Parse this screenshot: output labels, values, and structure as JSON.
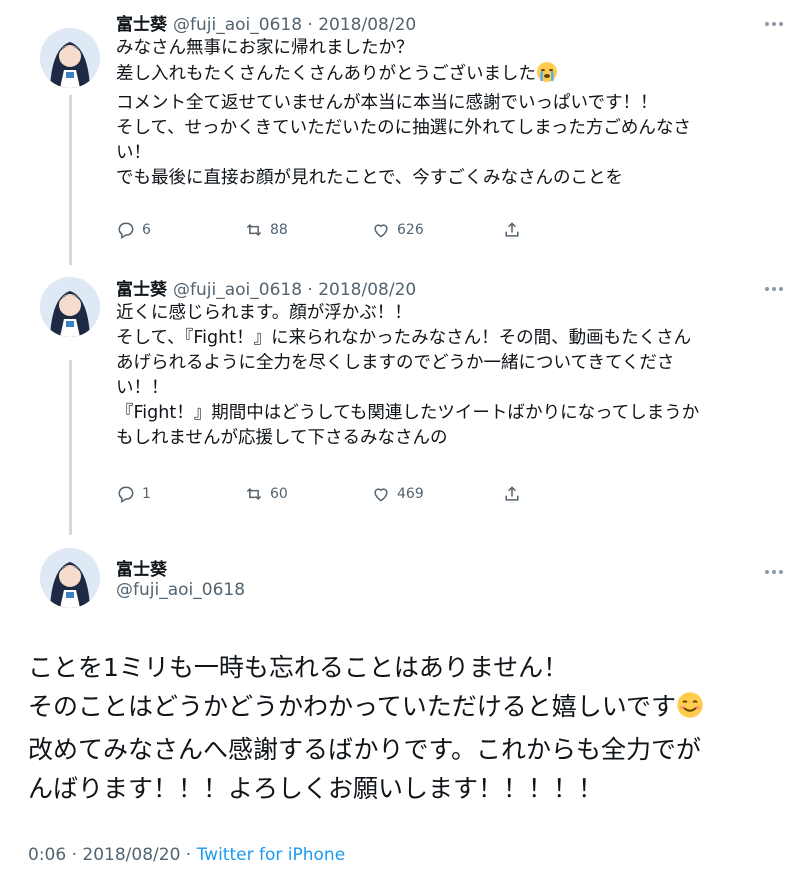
{
  "tweets": [
    {
      "name": "富士葵",
      "handle": "@fuji_aoi_0618",
      "date": "2018/08/20",
      "lines": [
        "みなさん無事にお家に帰れましたか？",
        "差し入れもたくさんたくさんありがとうございました",
        "コメント全て返せていませんが本当に本当に感謝でいっぱいです！！",
        "そして、せっかくきていただいたのに抽選に外れてしまった方ごめんなさ",
        "い！",
        "でも最後に直接お顔が見れたことで、今すごくみなさんのことを"
      ],
      "replies": "6",
      "retweets": "88",
      "likes": "626"
    },
    {
      "name": "富士葵",
      "handle": "@fuji_aoi_0618",
      "date": "2018/08/20",
      "lines": [
        "近くに感じられます。顔が浮かぶ！！",
        "そして、『Fight！』に来られなかったみなさん！その間、動画もたくさん",
        "あげられるように全力を尽くしますのでどうか一緒についてきてくださ",
        "い！！",
        "『Fight！』期間中はどうしても関連したツイートばかりになってしまうか",
        "もしれませんが応援して下さるみなさんの"
      ],
      "replies": "1",
      "retweets": "60",
      "likes": "469"
    }
  ],
  "main_tweet": {
    "name": "富士葵",
    "handle": "@fuji_aoi_0618",
    "lines": [
      "ことを1ミリも一時も忘れることはありません！",
      "そのことはどうかどうかわかっていただけると嬉しいです",
      "改めてみなさんへ感謝するばかりです。これからも全力でが",
      "んばります！！！よろしくお願いします！！！！！"
    ],
    "time": "0:06",
    "date": "2018/08/20",
    "source": "Twitter for iPhone"
  },
  "icons": {
    "reply": "reply-icon",
    "retweet": "retweet-icon",
    "like": "heart-icon",
    "share": "share-icon",
    "more": "more-icon",
    "crying_emoji": "crying-face-emoji",
    "smile_emoji": "smiling-face-emoji"
  },
  "colors": {
    "meta": "#536471",
    "link": "#1d9bf0",
    "thread_line": "#cfd9de"
  }
}
